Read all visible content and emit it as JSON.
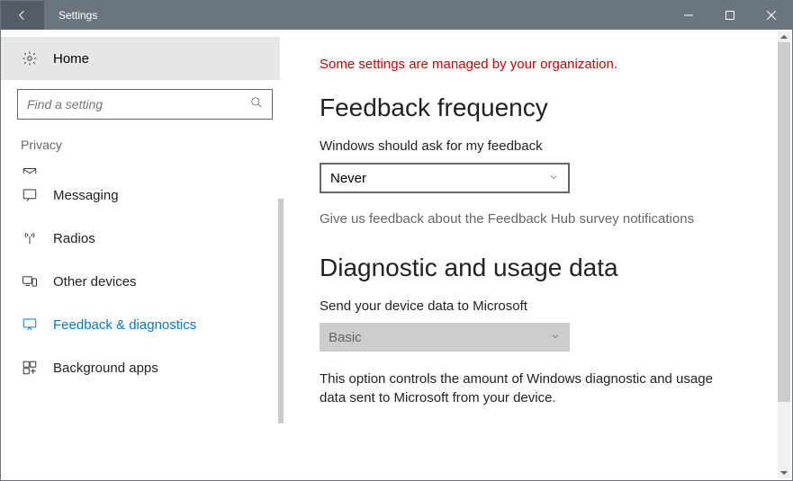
{
  "title": "Settings",
  "home_label": "Home",
  "search_placeholder": "Find a setting",
  "section": "Privacy",
  "sidebar": {
    "items": [
      {
        "label": "Messaging"
      },
      {
        "label": "Radios"
      },
      {
        "label": "Other devices"
      },
      {
        "label": "Feedback & diagnostics"
      },
      {
        "label": "Background apps"
      }
    ]
  },
  "org_notice": "Some settings are managed by your organization.",
  "feedback": {
    "title": "Feedback frequency",
    "label": "Windows should ask for my feedback",
    "value": "Never",
    "link": "Give us feedback about the Feedback Hub survey notifications"
  },
  "diagnostic": {
    "title": "Diagnostic and usage data",
    "label": "Send your device data to Microsoft",
    "value": "Basic",
    "desc": "This option controls the amount of Windows diagnostic and usage data sent to Microsoft from your device."
  }
}
